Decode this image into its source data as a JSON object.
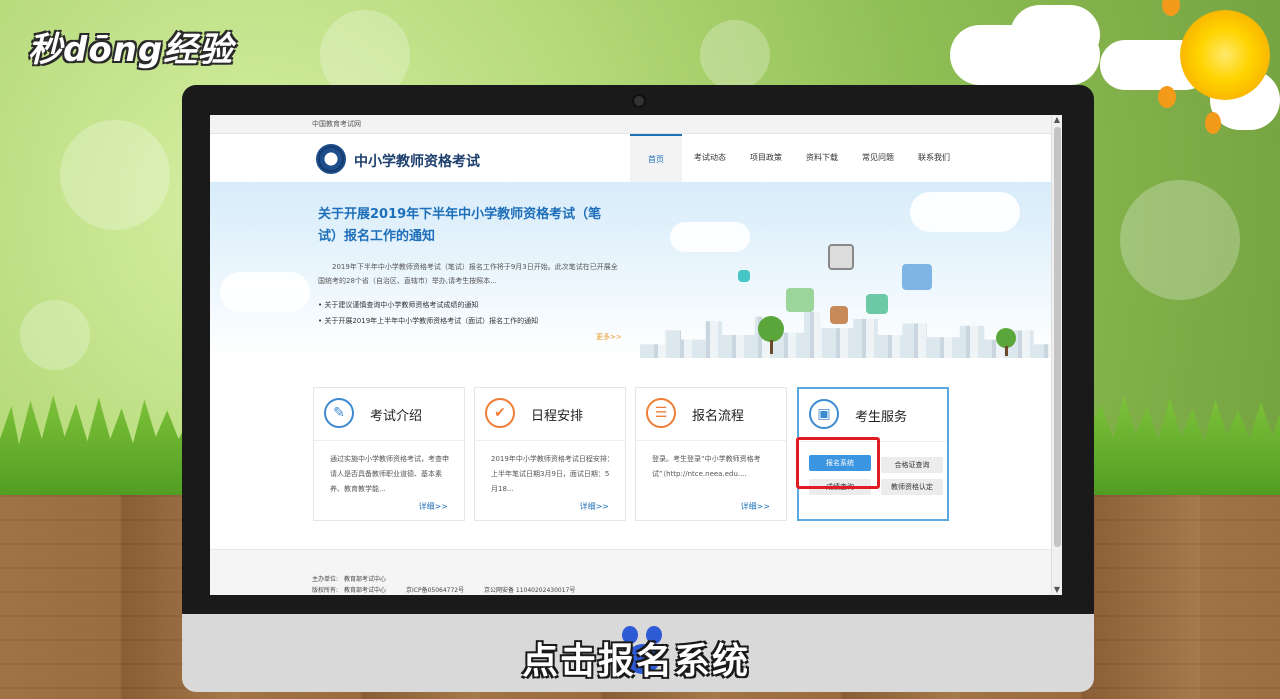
{
  "watermark": {
    "logo_text": "秒dōng经验"
  },
  "browser": {
    "top_strip": "中国教育考试网",
    "site_title": "中小学教师资格考试",
    "nav": [
      "首页",
      "考试动态",
      "项目政策",
      "资料下载",
      "常见问题",
      "联系我们"
    ],
    "nav_active": "首页",
    "banner": {
      "title": "关于开展2019年下半年中小学教师资格考试（笔试）报名工作的通知",
      "description": "2019年下半年中小学教师资格考试（笔试）报名工作将于9月3日开始。此次笔试在已开展全国统考的28个省（自治区、直辖市）举办,请考生按照本...",
      "links": [
        "• 关于建议谨慎查询中小学教师资格考试成绩的通知",
        "• 关于开展2019年上半年中小学教师资格考试（面试）报名工作的通知"
      ],
      "more": "更多>>"
    },
    "cards": [
      {
        "title": "考试介绍",
        "icon": "document-pen-icon",
        "text": "通过实施中小学教师资格考试，考查申请人是否具备教师职业道德、基本素养、教育教学能...",
        "more": "详细>>"
      },
      {
        "title": "日程安排",
        "icon": "checkmark-icon",
        "text": "2019年中小学教师资格考试日程安排：上半年笔试日期3月9日，面试日期：5月18...",
        "more": "详细>>"
      },
      {
        "title": "报名流程",
        "icon": "form-icon",
        "text": "登录。考生登录“中小学教师资格考试”（http://ntce.neea.edu....",
        "more": "详细>>"
      },
      {
        "title": "考生服务",
        "icon": "id-card-icon"
      }
    ],
    "service_buttons": {
      "register": "报名系统",
      "certificate_query": "合格证查询",
      "score_query": "成绩查询",
      "teacher_cert": "教师资格认定"
    },
    "footer": {
      "host_label": "主办单位:",
      "host": "教育部考试中心",
      "copyright_label": "版权所有:",
      "copyright": "教育部考试中心",
      "icp": "京ICP备05064772号",
      "police": "京公网安备 11040202430017号"
    }
  },
  "caption": "点击报名系统",
  "colors": {
    "accent": "#1e6fba",
    "highlight": "#e11b22",
    "primary_button": "#3c95e0"
  }
}
